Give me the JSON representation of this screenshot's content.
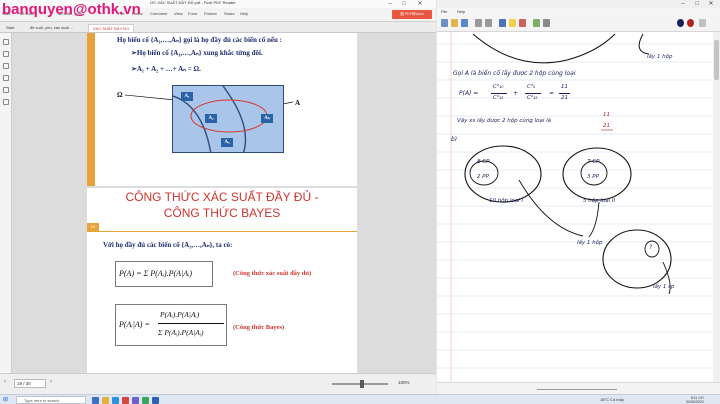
{
  "watermark": "banquyen@othk.vn",
  "pdf": {
    "window_title": "ỨC XÁC SUẤT ĐẦY ĐỦ.pdf - Foxit PDF Reader",
    "ribbon_items": [
      "Start",
      "đỗ cuối, y",
      "đỗ xoắn, gom",
      "File",
      "Home",
      "Comment",
      "View",
      "Form",
      "Protect",
      "Share",
      "Help"
    ],
    "tabs": [
      "Start",
      "đề cuối, y/m, xác suất ...",
      "XÁC SUẤT ĐẦY ĐỦ"
    ],
    "page_input": "19 / 30",
    "zoom_level": "100%",
    "slide1": {
      "line1": "Họ biến cố {A₁,…,Aₙ} gọi là họ đầy đủ các biến cố nếu :",
      "bullet1": "Họ biến cố {A₁,…,Aₙ} xung khắc từng đôi.",
      "bullet2": "A₁ + A₂ + …+ Aₙ = Ω.",
      "venn_omega": "Ω",
      "venn_a": "A",
      "venn_boxes": [
        "A₁",
        "A₂",
        "Aₙ",
        "A₃"
      ]
    },
    "slide2": {
      "title_line1": "CÔNG THỨC XÁC SUẤT ĐẦY ĐỦ -",
      "title_line2": "CÔNG THỨC BAYES",
      "page_number": "19",
      "intro": "Với họ đầy đủ các biến cố {A₁,…,Aₙ}, ta có:",
      "formula1": "P(A) = Σ P(Aᵢ).P(A|Aᵢ)",
      "formula1_note": "(Công thức xác suất đầy đủ)",
      "formula2_left": "P(Aᵢ|A) =",
      "formula2_num": "P(Aᵢ).P(A|Aᵢ)",
      "formula2_den": "Σ P(Aᵢ).P(A|Aᵢ)",
      "formula2_note": "(Công thức Bayes)"
    }
  },
  "notes": {
    "menu_items": [
      "File",
      "Help"
    ],
    "handwriting": {
      "box_label": "lấy 1 hộp",
      "line_gọi": "Gọi A là biến cố lấy được 2 hộp cùng loại",
      "pa_left": "P(A) =",
      "frac1_num": "C²₁₀",
      "frac1_den": "C²₁₅",
      "plus": "+",
      "frac2_num": "C²₅",
      "frac2_den": "C²₁₅",
      "eq1": "=",
      "frac3_num": "11",
      "frac3_den": "21",
      "vay": "Vậy xs lấy được 2 hộp cùng loại là",
      "answer_num": "11",
      "answer_den": "21",
      "b_label": "b)",
      "box1_top": "8 CP",
      "box1_bottom": "2 PP",
      "box2_top": "7 CP",
      "box2_bottom": "3 PP",
      "box1_caption": "10 hộp loại I",
      "box2_caption": "5 hộp loại II",
      "pick_box": "lấy 1 hộp",
      "pick_product": "lấy 1 sp",
      "q": "?"
    }
  },
  "taskbar": {
    "search_placeholder": "Type here to search",
    "weather": "18°C Có mây",
    "time": "8:11 CH",
    "date": "30/05/2023"
  }
}
